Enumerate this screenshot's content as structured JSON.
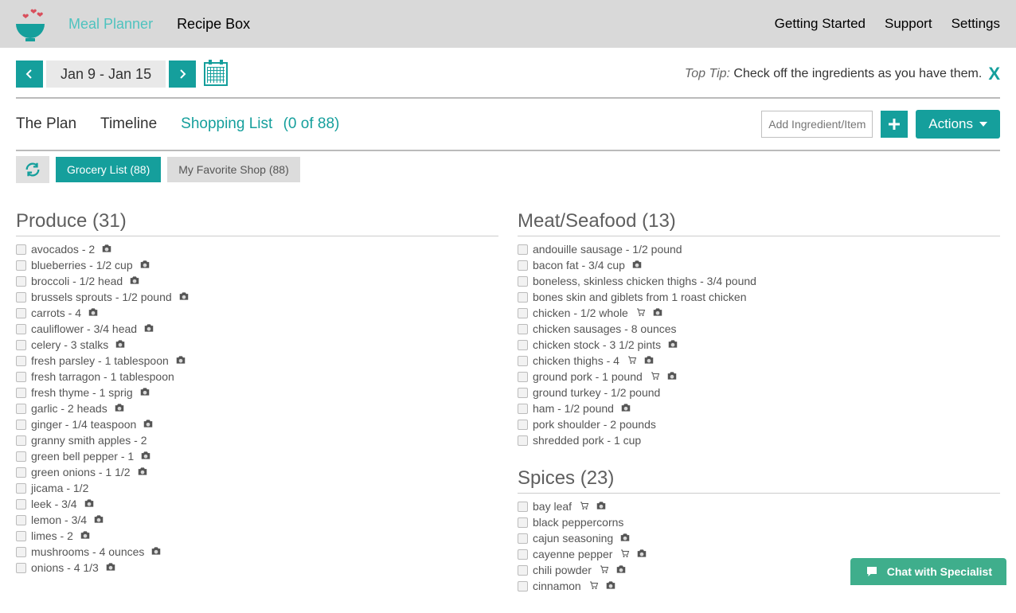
{
  "nav": {
    "meal_planner": "Meal Planner",
    "recipe_box": "Recipe Box",
    "getting_started": "Getting Started",
    "support": "Support",
    "settings": "Settings"
  },
  "date_range": "Jan 9 - Jan 15",
  "top_tip_label": "Top Tip:",
  "top_tip_text": "Check off the ingredients as you have them.",
  "close_x": "X",
  "tabs": {
    "plan": "The Plan",
    "timeline": "Timeline",
    "shopping": "Shopping List",
    "shopping_count": "(0 of 88)"
  },
  "add_placeholder": "Add Ingredient/Item",
  "actions_label": "Actions",
  "subtabs": {
    "grocery": "Grocery List (88)",
    "favorite": "My Favorite Shop (88)"
  },
  "categories": [
    {
      "col": 0,
      "title": "Produce (31)",
      "items": [
        {
          "t": "avocados - 2",
          "cam": true
        },
        {
          "t": "blueberries - 1/2 cup",
          "cam": true
        },
        {
          "t": "broccoli - 1/2 head",
          "cam": true
        },
        {
          "t": "brussels sprouts - 1/2 pound",
          "cam": true
        },
        {
          "t": "carrots - 4",
          "cam": true
        },
        {
          "t": "cauliflower - 3/4 head",
          "cam": true
        },
        {
          "t": "celery - 3 stalks",
          "cam": true
        },
        {
          "t": "fresh parsley - 1 tablespoon",
          "cam": true
        },
        {
          "t": "fresh tarragon - 1 tablespoon"
        },
        {
          "t": "fresh thyme - 1 sprig",
          "cam": true
        },
        {
          "t": "garlic - 2 heads",
          "cam": true
        },
        {
          "t": "ginger - 1/4 teaspoon",
          "cam": true
        },
        {
          "t": "granny smith apples - 2"
        },
        {
          "t": "green bell pepper - 1",
          "cam": true
        },
        {
          "t": "green onions - 1 1/2",
          "cam": true
        },
        {
          "t": "jicama - 1/2"
        },
        {
          "t": "leek - 3/4",
          "cam": true
        },
        {
          "t": "lemon - 3/4",
          "cam": true
        },
        {
          "t": "limes - 2",
          "cam": true
        },
        {
          "t": "mushrooms - 4 ounces",
          "cam": true
        },
        {
          "t": "onions - 4 1/3",
          "cam": true
        }
      ]
    },
    {
      "col": 1,
      "title": "Meat/Seafood (13)",
      "items": [
        {
          "t": "andouille sausage - 1/2 pound"
        },
        {
          "t": "bacon fat - 3/4 cup",
          "cam": true
        },
        {
          "t": "boneless, skinless chicken thighs - 3/4 pound"
        },
        {
          "t": "bones skin and giblets from 1 roast chicken"
        },
        {
          "t": "chicken - 1/2 whole",
          "cart": true,
          "cam": true
        },
        {
          "t": "chicken sausages - 8 ounces"
        },
        {
          "t": "chicken stock - 3 1/2 pints",
          "cam": true
        },
        {
          "t": "chicken thighs - 4",
          "cart": true,
          "cam": true
        },
        {
          "t": "ground pork - 1 pound",
          "cart": true,
          "cam": true
        },
        {
          "t": "ground turkey - 1/2 pound"
        },
        {
          "t": "ham - 1/2 pound",
          "cam": true
        },
        {
          "t": "pork shoulder - 2 pounds"
        },
        {
          "t": "shredded pork - 1 cup"
        }
      ]
    },
    {
      "col": 1,
      "title": "Spices (23)",
      "items": [
        {
          "t": "bay leaf",
          "cart": true,
          "cam": true
        },
        {
          "t": "black peppercorns"
        },
        {
          "t": "cajun seasoning",
          "cam": true
        },
        {
          "t": "cayenne pepper",
          "cart": true,
          "cam": true
        },
        {
          "t": "chili powder",
          "cart": true,
          "cam": true
        },
        {
          "t": "cinnamon",
          "cart": true,
          "cam": true
        }
      ]
    }
  ],
  "chat_label": "Chat with Specialist"
}
